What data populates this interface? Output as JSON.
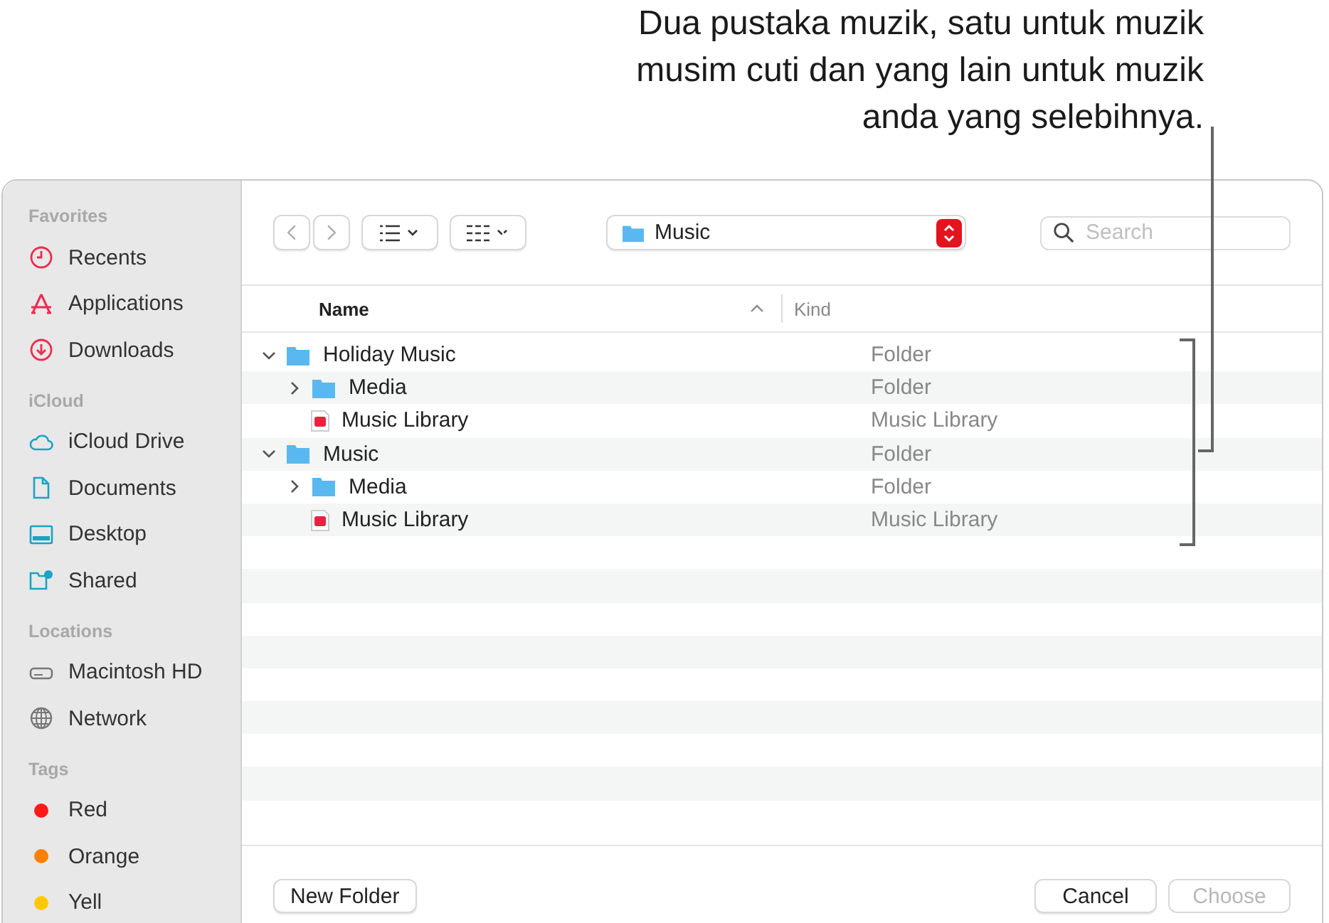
{
  "callout": {
    "text": "Dua pustaka muzik, satu untuk muzik musim cuti dan yang lain untuk muzik anda yang selebihnya."
  },
  "sidebar": {
    "sections": [
      {
        "title": "Favorites",
        "items": [
          {
            "label": "Recents",
            "kind": "clock"
          },
          {
            "label": "Applications",
            "kind": "apps"
          },
          {
            "label": "Downloads",
            "kind": "download"
          }
        ]
      },
      {
        "title": "iCloud",
        "items": [
          {
            "label": "iCloud Drive",
            "kind": "cloud"
          },
          {
            "label": "Documents",
            "kind": "doc"
          },
          {
            "label": "Desktop",
            "kind": "desktop"
          },
          {
            "label": "Shared",
            "kind": "shared"
          }
        ]
      },
      {
        "title": "Locations",
        "items": [
          {
            "label": "Macintosh HD",
            "kind": "disk"
          },
          {
            "label": "Network",
            "kind": "globe"
          }
        ]
      },
      {
        "title": "Tags",
        "items": [
          {
            "label": "Red",
            "kind": "tag",
            "color": "#ff1a1a"
          },
          {
            "label": "Orange",
            "kind": "tag",
            "color": "#ff8000"
          },
          {
            "label": "Yell",
            "kind": "tag",
            "color": "#ffc800"
          }
        ]
      }
    ]
  },
  "toolbar": {
    "location": "Music",
    "search": {
      "placeholder": "Search"
    }
  },
  "table": {
    "columns": [
      "Name",
      "Kind"
    ],
    "rows": [
      {
        "name": "Holiday Music",
        "kind_column": "Folder",
        "kind": "folder",
        "expanded": true,
        "children": [
          {
            "name": "Media",
            "kind_column": "Folder",
            "kind": "folder",
            "expanded": false
          },
          {
            "name": "Music Library",
            "kind_column": "Music Library",
            "kind": "library"
          }
        ]
      },
      {
        "name": "Music",
        "kind_column": "Folder",
        "kind": "folder",
        "expanded": true,
        "children": [
          {
            "name": "Media",
            "kind_column": "Folder",
            "kind": "folder",
            "expanded": false
          },
          {
            "name": "Music Library",
            "kind_column": "Music Library",
            "kind": "library"
          }
        ]
      }
    ]
  },
  "buttons": [
    {
      "label": "New Folder",
      "disabled": false
    },
    {
      "label": "Cancel",
      "disabled": false
    },
    {
      "label": "Choose",
      "disabled": true
    }
  ]
}
